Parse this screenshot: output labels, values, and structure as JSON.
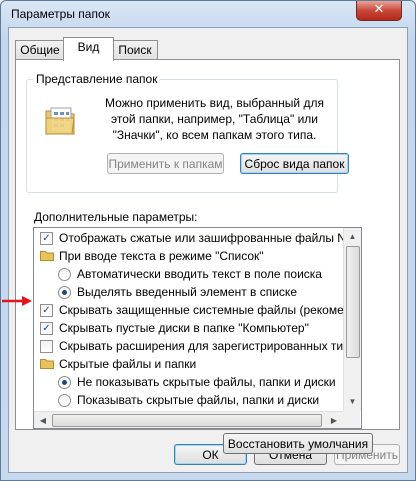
{
  "window": {
    "title": "Параметры папок",
    "close_glyph": "✕"
  },
  "tabs": [
    {
      "label": "Общие"
    },
    {
      "label": "Вид"
    },
    {
      "label": "Поиск"
    }
  ],
  "folder_view": {
    "group_title": "Представление папок",
    "description": "Можно применить вид, выбранный для этой папки, например, \"Таблица\" или \"Значки\", ко всем папкам этого типа.",
    "apply_button": "Применить к папкам",
    "reset_button": "Сброс вида папок"
  },
  "advanced": {
    "label": "Дополнительные параметры:",
    "items": [
      {
        "type": "checkbox",
        "checked": true,
        "indent": 0,
        "text": "Отображать сжатые или зашифрованные файлы NTFS другим цветом"
      },
      {
        "type": "folder",
        "indent": 0,
        "text": "При вводе текста в режиме \"Список\""
      },
      {
        "type": "radio",
        "checked": false,
        "indent": 1,
        "text": "Автоматически вводить текст в поле поиска"
      },
      {
        "type": "radio",
        "checked": true,
        "indent": 1,
        "text": "Выделять введенный элемент в списке"
      },
      {
        "type": "checkbox",
        "checked": true,
        "indent": 0,
        "text": "Скрывать защищенные системные файлы (рекомендуется)"
      },
      {
        "type": "checkbox",
        "checked": true,
        "indent": 0,
        "text": "Скрывать пустые диски в папке \"Компьютер\""
      },
      {
        "type": "checkbox",
        "checked": false,
        "indent": 0,
        "text": "Скрывать расширения для зарегистрированных типов файлов"
      },
      {
        "type": "folder",
        "indent": 0,
        "text": "Скрытые файлы и папки"
      },
      {
        "type": "radio",
        "checked": true,
        "indent": 1,
        "text": "Не показывать скрытые файлы, папки и диски"
      },
      {
        "type": "radio",
        "checked": false,
        "indent": 1,
        "text": "Показывать скрытые файлы, папки и диски"
      }
    ]
  },
  "restore_button": "Восстановить умолчания",
  "footer": {
    "ok": "ОК",
    "cancel": "Отмена",
    "apply": "Применить"
  },
  "scroll_glyphs": {
    "up": "▲",
    "down": "▼",
    "left": "◀",
    "right": "▶"
  },
  "colors": {
    "annotation_arrow": "#e8141b",
    "close_button": "#c9493a",
    "folder": "#e8c25a"
  }
}
